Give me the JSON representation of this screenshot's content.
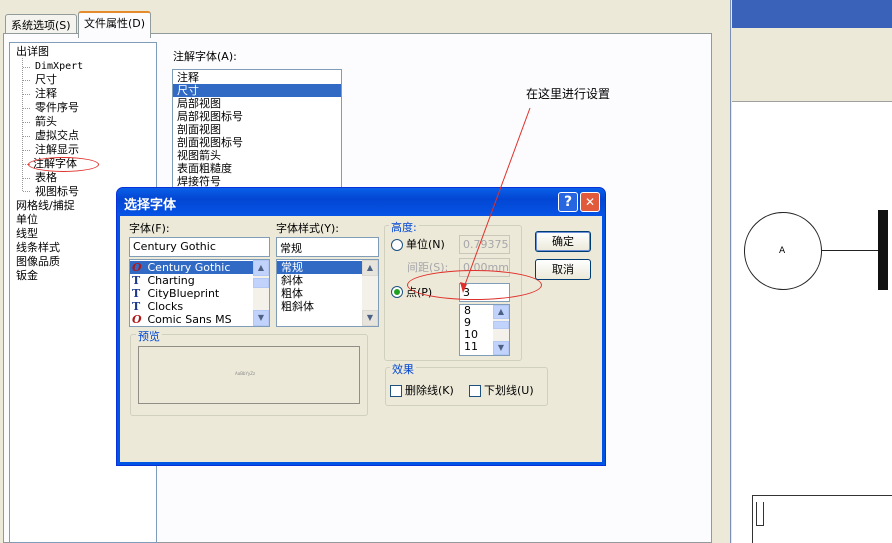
{
  "tabs": [
    {
      "label": "系统选项(S)"
    },
    {
      "label": "文件属性(D)"
    }
  ],
  "tree": {
    "items": [
      {
        "label": "出详图"
      },
      {
        "label": "DimXpert"
      },
      {
        "label": "尺寸"
      },
      {
        "label": "注释"
      },
      {
        "label": "零件序号"
      },
      {
        "label": "箭头"
      },
      {
        "label": "虚拟交点"
      },
      {
        "label": "注解显示"
      },
      {
        "label": "注解字体"
      },
      {
        "label": "表格"
      },
      {
        "label": "视图标号"
      },
      {
        "label": "网格线/捕捉"
      },
      {
        "label": "单位"
      },
      {
        "label": "线型"
      },
      {
        "label": "线条样式"
      },
      {
        "label": "图像品质"
      },
      {
        "label": "钣金"
      }
    ]
  },
  "annotation_font": {
    "label": "注解字体(A):",
    "items": [
      "注释",
      "尺寸",
      "局部视图",
      "局部视图标号",
      "剖面视图",
      "剖面视图标号",
      "视图箭头",
      "表面粗糙度",
      "焊接符号"
    ],
    "selected": "尺寸"
  },
  "callout_text": "在这里进行设置",
  "dialog": {
    "title": "选择字体",
    "help": "?",
    "close": "✕",
    "font": {
      "label": "字体(F):",
      "value": "Century Gothic",
      "options": [
        {
          "name": "Century Gothic",
          "icon": "O",
          "selected": true
        },
        {
          "name": "Charting",
          "icon": "T"
        },
        {
          "name": "CityBlueprint",
          "icon": "T"
        },
        {
          "name": "Clocks",
          "icon": "T"
        },
        {
          "name": "Comic Sans MS",
          "icon": "O"
        }
      ]
    },
    "style": {
      "label": "字体样式(Y):",
      "value": "常规",
      "options": [
        "常规",
        "斜体",
        "粗体",
        "粗斜体"
      ]
    },
    "height": {
      "group_label": "高度:",
      "unit_label": "单位(N)",
      "unit_value": "0.79375m",
      "spacing_label": "间距(S):",
      "spacing_value": "0.00mm",
      "point_label": "点(P)",
      "point_value": "3",
      "point_options": [
        "8",
        "9",
        "10",
        "11"
      ]
    },
    "ok": "确定",
    "cancel": "取消",
    "preview_label": "预览",
    "preview_sample": "AaBbYyZz",
    "effects": {
      "group_label": "效果",
      "strike": "删除线(K)",
      "underline": "下划线(U)"
    }
  },
  "canvas": {
    "circle_label": "A"
  }
}
